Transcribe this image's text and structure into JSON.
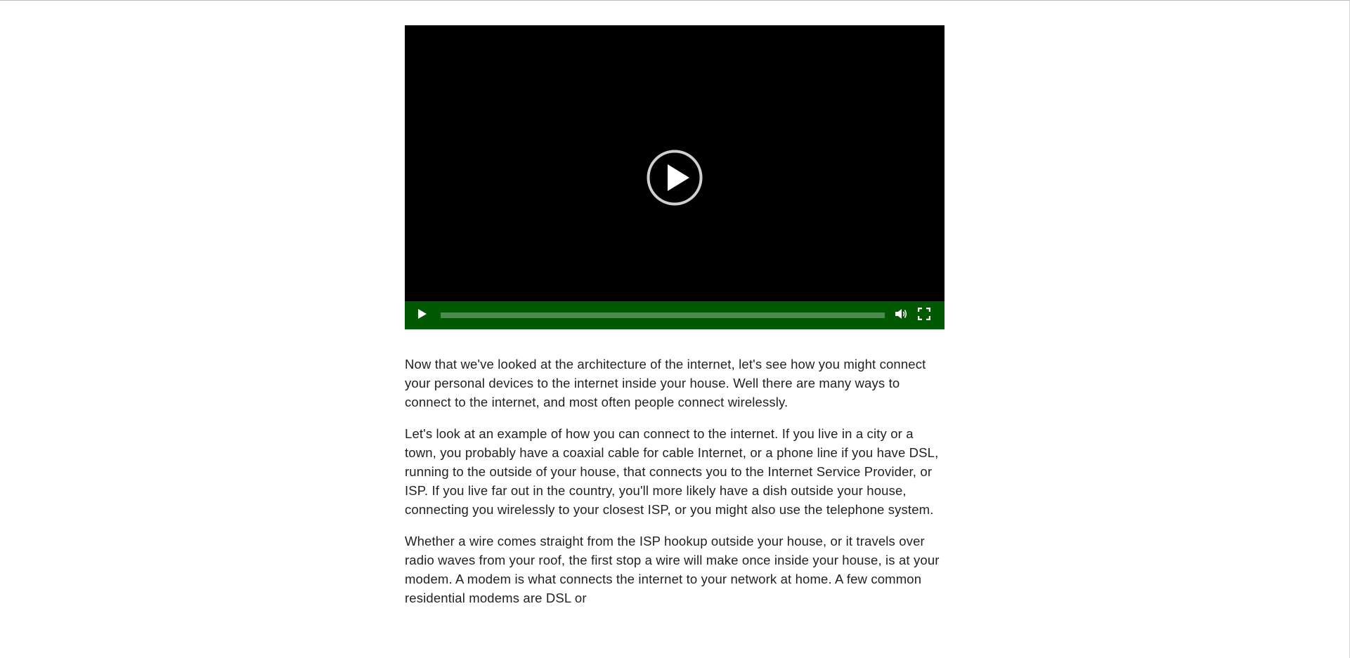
{
  "video": {
    "progress_fraction": 0,
    "big_play_icon": "play-circle-icon",
    "controls": {
      "play_icon": "play-icon",
      "volume_icon": "volume-icon",
      "fullscreen_icon": "fullscreen-icon"
    },
    "colors": {
      "controls_bg": "#015a01",
      "seek_track": "#4d8a4d"
    }
  },
  "article": {
    "paragraphs": [
      "Now that we've looked at the architecture of the internet, let's see how you might connect your personal devices to the internet inside your house. Well there are many ways to connect to the internet, and most often people connect wirelessly.",
      "Let's look at an example of how you can connect to the internet. If you live in a city or a town, you probably have a coaxial cable for cable Internet, or a phone line if you have DSL, running to the outside of your house, that connects you to the Internet Service Provider, or ISP. If you live far out in the country, you'll more likely have a dish outside your house, connecting you wirelessly to your closest ISP, or you might also use the telephone system.",
      "Whether a wire comes straight from the ISP hookup outside your house, or it travels over radio waves from your roof, the first stop a wire will make once inside your house, is at your modem. A modem is what connects the internet to your network at home. A few common residential modems are DSL or"
    ]
  }
}
